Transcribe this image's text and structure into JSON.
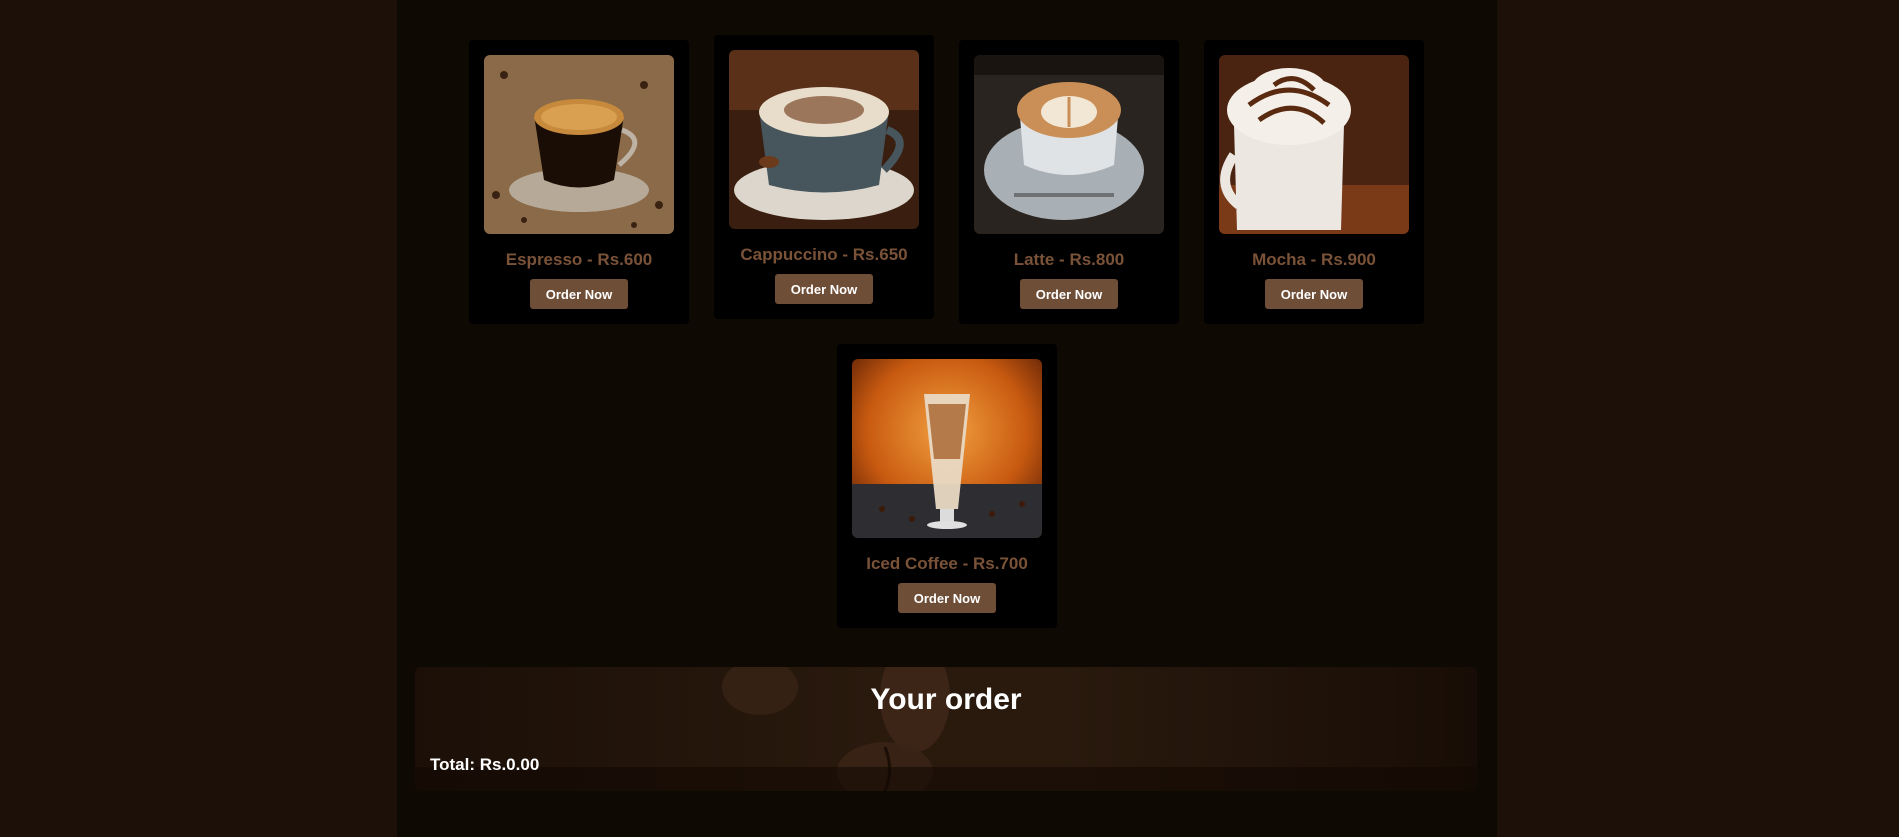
{
  "menu": {
    "items": [
      {
        "label": "Espresso - Rs.600",
        "button": "Order Now",
        "image_icon": "espresso-photo"
      },
      {
        "label": "Cappuccino - Rs.650",
        "button": "Order Now",
        "image_icon": "cappuccino-photo"
      },
      {
        "label": "Latte - Rs.800",
        "button": "Order Now",
        "image_icon": "latte-photo"
      },
      {
        "label": "Mocha - Rs.900",
        "button": "Order Now",
        "image_icon": "mocha-photo"
      },
      {
        "label": "Iced Coffee - Rs.700",
        "button": "Order Now",
        "image_icon": "iced-coffee-photo"
      }
    ]
  },
  "order": {
    "title": "Your order",
    "total": "Total: Rs.0.00"
  },
  "colors": {
    "background": "#1c1008",
    "content_background": "#0f0904",
    "card_background": "#000000",
    "item_label": "#7a5238",
    "button": "#6f4e37",
    "button_text": "#ffffff"
  }
}
